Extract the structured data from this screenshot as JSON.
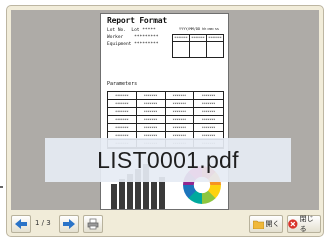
{
  "overlay": {
    "filename": "LIST0001.pdf"
  },
  "document": {
    "title": "Report Format",
    "lot_line": "Lot No.  Lot *****",
    "worker_line": "Worker    *********",
    "equipment_line": "Equipment *********",
    "datetime": "YYYY/MM/DD hh:mm:ss",
    "sign_headers": [
      "*******",
      "*******",
      "*******"
    ],
    "params_heading": "Parameters",
    "param_cells": [
      "*******",
      "*******",
      "*******",
      "*******",
      "*******",
      "*******",
      "*******",
      "*******",
      "*******",
      "*******",
      "*******",
      "*******",
      "*******",
      "*******",
      "*******",
      "*******",
      "*******",
      "*******",
      "*******",
      "*******",
      "*******",
      "*******",
      "*******",
      "*******",
      "*******",
      "*******",
      "*******",
      "*******"
    ],
    "bar_levels": [
      0.55,
      0.65,
      0.75,
      0.85,
      0.95,
      0.6,
      0.7
    ],
    "pie_colors": [
      "#e8262b",
      "#f79420",
      "#fdd20e",
      "#8dc63f",
      "#00a99d",
      "#1c75bc",
      "#92278f",
      "#ec008c"
    ]
  },
  "toolbar": {
    "page_indicator": "1 / 3",
    "open_label": "開く",
    "close_label": "閉じる"
  },
  "colors": {
    "accent_blue": "#2a73c8",
    "close_red": "#d9342b",
    "folder_yellow": "#f0b839"
  }
}
